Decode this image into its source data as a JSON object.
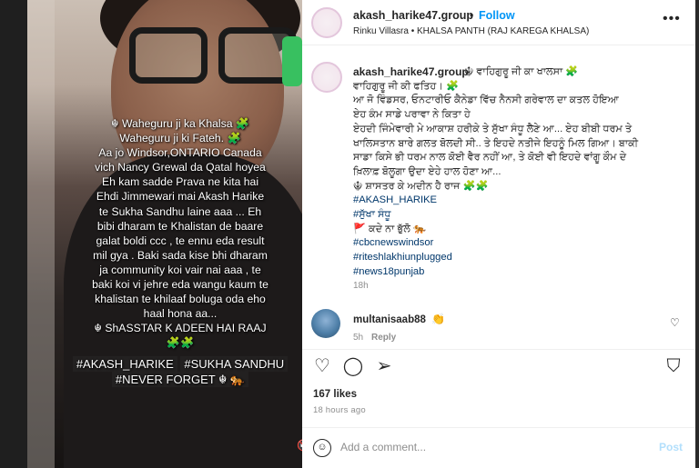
{
  "media": {
    "caption_lines": [
      "☬ Waheguru ji ka Khalsa 🧩",
      "Waheguru ji ki Fateh. 🧩",
      "Aa jo Windsor,ONTARIO Canada",
      "vich Nancy Grewal da Qatal hoyea",
      "Eh kam sadde Prava ne kita hai",
      "Ehdi Jimmewari mai Akash Harike",
      "te Sukha Sandhu  laine aaa ... Eh",
      "bibi dharam te Khalistan de baare",
      "galat boldi ccc , te ennu eda result",
      "mil gya . Baki sada kise bhi dharam",
      "ja community koi vair nai aaa , te",
      "baki koi vi jehre eda wangu kaum te",
      "khalistan te khilaaf boluga oda eho",
      "haal hona aa...",
      "☬ ShASSTAR K ADEEN HAI RAAJ",
      "🧩🧩"
    ],
    "hashtags": [
      "#AKASH_HARIKE",
      "#SUKHA SANDHU",
      "#NEVER FORGET ☬ 🐅"
    ],
    "mute_icon": "🔇"
  },
  "post": {
    "header": {
      "username": "akash_harike47.group",
      "separator": "•",
      "follow_label": "Follow",
      "subtitle": "Rinku Villasra • KHALSA PANTH (RAJ KAREGA KHALSA)",
      "more_icon": "•••"
    },
    "caption": {
      "username": "akash_harike47.group",
      "lines": [
        "☬ ਵਾਹਿਗੁਰੂ ਜੀ ਕਾ ਖਾਲਸਾ 🧩",
        "ਵਾਹਿਗੁਰੂ ਜੀ ਕੀ ਫਤਿਹ। 🧩",
        "ਆ ਜੋ ਵਿੰਡਸਰ, ਓਨਟਾਰੀਓ ਕੈਨੇਡਾ ਵਿੱਚ ਨੈਨਸੀ ਗਰੇਵਾਲ ਦਾ ਕਤਲ ਹੋਇਆ",
        "ਏਹ ਕੰਮ ਸਾਡੇ ਪਰਾਵਾ ਨੇ ਕਿਤਾ ਹੇ",
        "ਏਹਦੀ ਜਿੰਮੇਵਾਰੀ ਮੇ ਆਕਾਸ਼ ਹਰੀਕੇ ਤੇ ਸੁੱਖਾ ਸੰਧੂ ਲੈਣੇ ਆ... ਏਹ ਬੀਬੀ ਧਰਮ ਤੇ",
        "ਖਾਲਿਸਤਾਨ ਬਾਰੇ ਗਲਤ ਬੋਲਦੀ ਸੀ.. ਤੇ ਇਹਦੇ ਨਤੀਜੇ ਇਹਨੂੰ ਮਿਲ ਗਿਆ। ਬਾਕੀ",
        "ਸਾਡਾ ਕਿਸੇ ਭੀ ਧਰਮ ਨਾਲ ਕੋਈ ਵੈਰ ਨਹੀਂ ਆ, ਤੇ ਕੋਈ ਵੀ ਇਹਦੇ ਵਾਂਗੂ ਕੌਮ ਦੇ",
        "ਖ਼ਿਲਾਫ਼ ਬੋਲੂਗਾ ਉਦਾ ਏਹੇ ਹਾਲ ਹੋਣਾ ਆ...",
        "☬ ਸ਼ਾਸਤਰ ਕੇ ਅਦੀਨ ਹੈ ਰਾਜ 🧩🧩"
      ],
      "hashtags": [
        "#AKASH_HARIKE",
        "#ਸੁੱਖਾ ਸੰਧੂ",
        "🚩 ਕਦੇ ਨਾ ਭੁੱਲੋ 🐅",
        "#cbcnewswindsor",
        "#riteshlakhiunplugged",
        "#news18punjab"
      ],
      "time": "18h"
    },
    "comment": {
      "username": "multanisaab88",
      "emoji": "👏",
      "time": "5h",
      "reply_label": "Reply",
      "like_icon": "♡"
    },
    "actions": {
      "like_icon": "♡",
      "comment_icon": "◯",
      "share_icon": "➢",
      "save_icon": "⛉"
    },
    "likes": "167 likes",
    "posted_ago": "18 hours ago",
    "add_comment": {
      "emoji_icon": "☺",
      "placeholder": "Add a comment...",
      "post_label": "Post"
    }
  }
}
